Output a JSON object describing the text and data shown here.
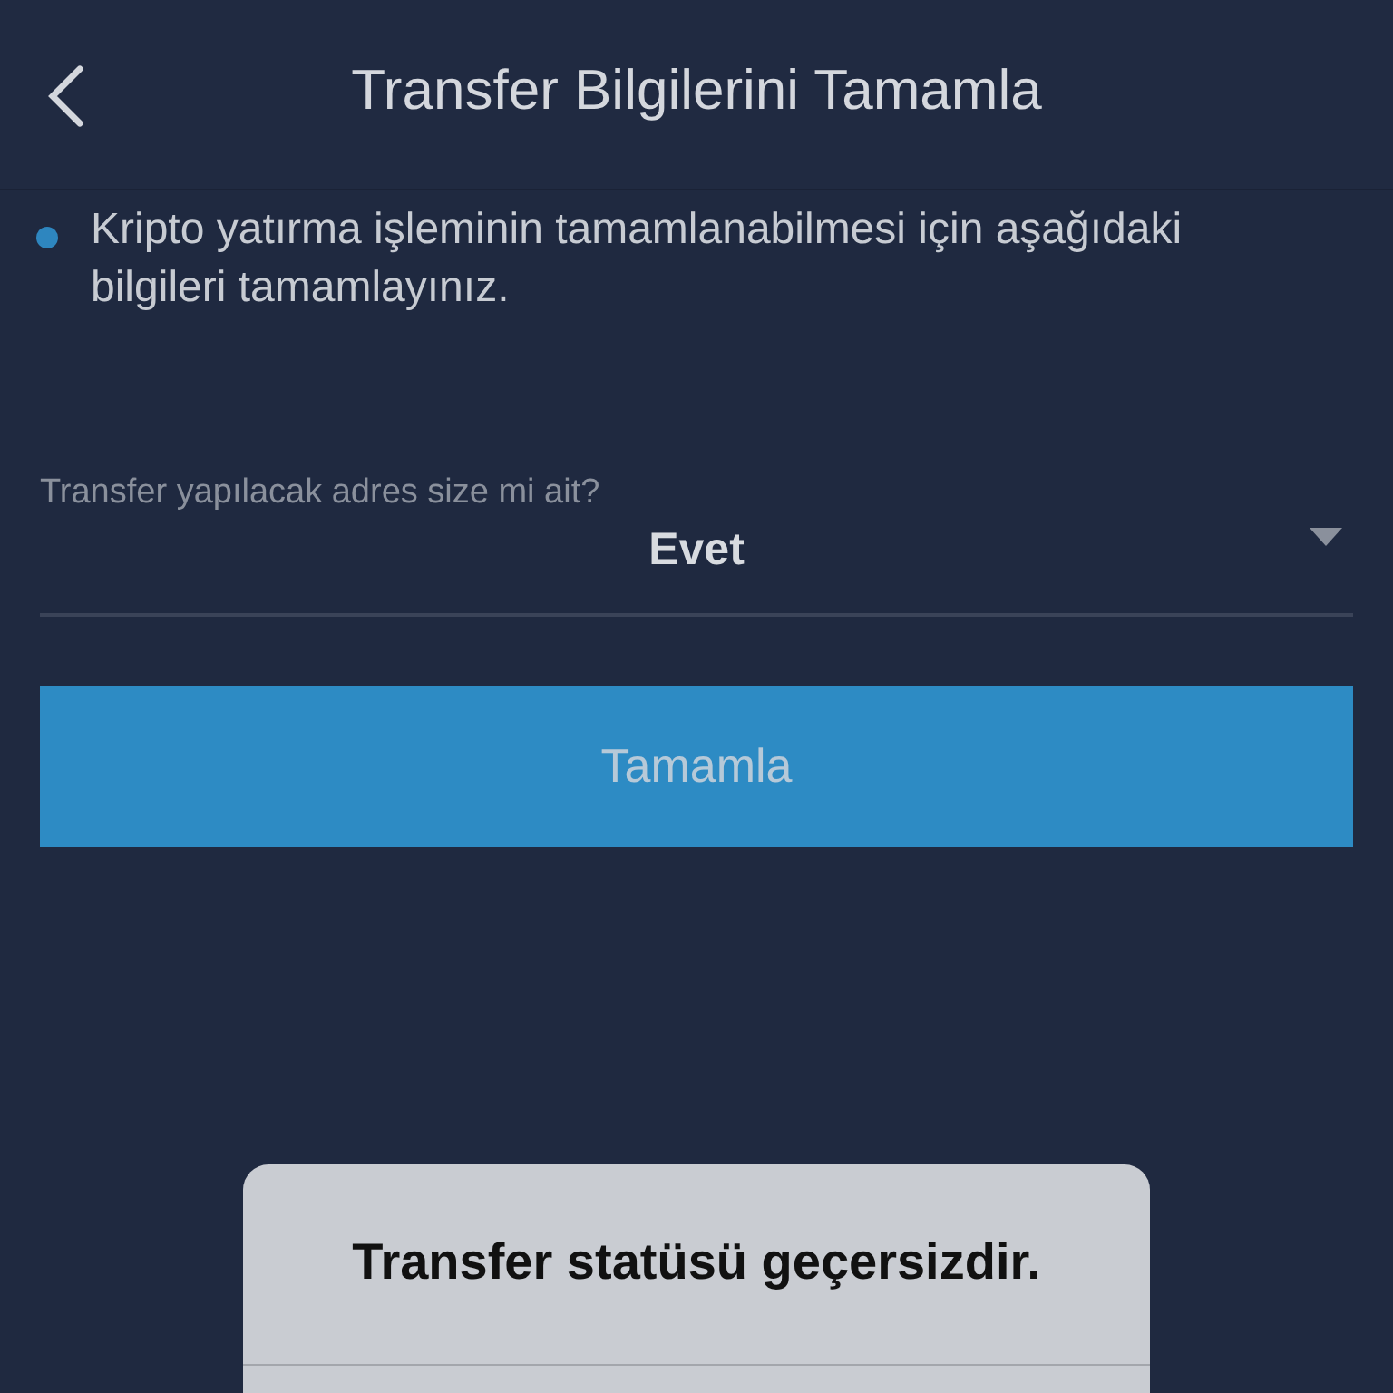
{
  "header": {
    "title": "Transfer Bilgilerini Tamamla"
  },
  "notice": {
    "text": "Kripto yatırma işleminin tamamlanabilmesi için aşağıdaki bilgileri tamamlayınız."
  },
  "select": {
    "label": "Transfer yapılacak adres size mi ait?",
    "value": "Evet"
  },
  "primary_button": {
    "label": "Tamamla"
  },
  "alert": {
    "message": "Transfer statüsü geçersizdir."
  }
}
